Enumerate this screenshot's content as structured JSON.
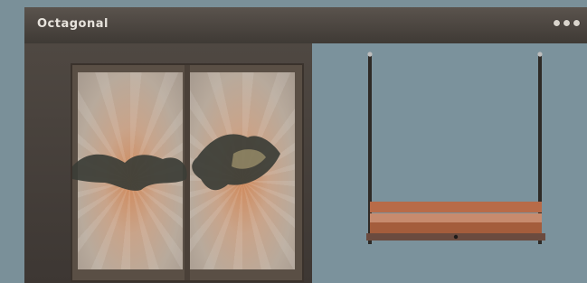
{
  "window": {
    "title": "Octagonal",
    "controls": [
      "min-dot",
      "max-dot",
      "close-dot"
    ]
  },
  "preview": {
    "left_image": "stained-glass-door-with-bats",
    "right_image": "porch-swing-bench"
  }
}
